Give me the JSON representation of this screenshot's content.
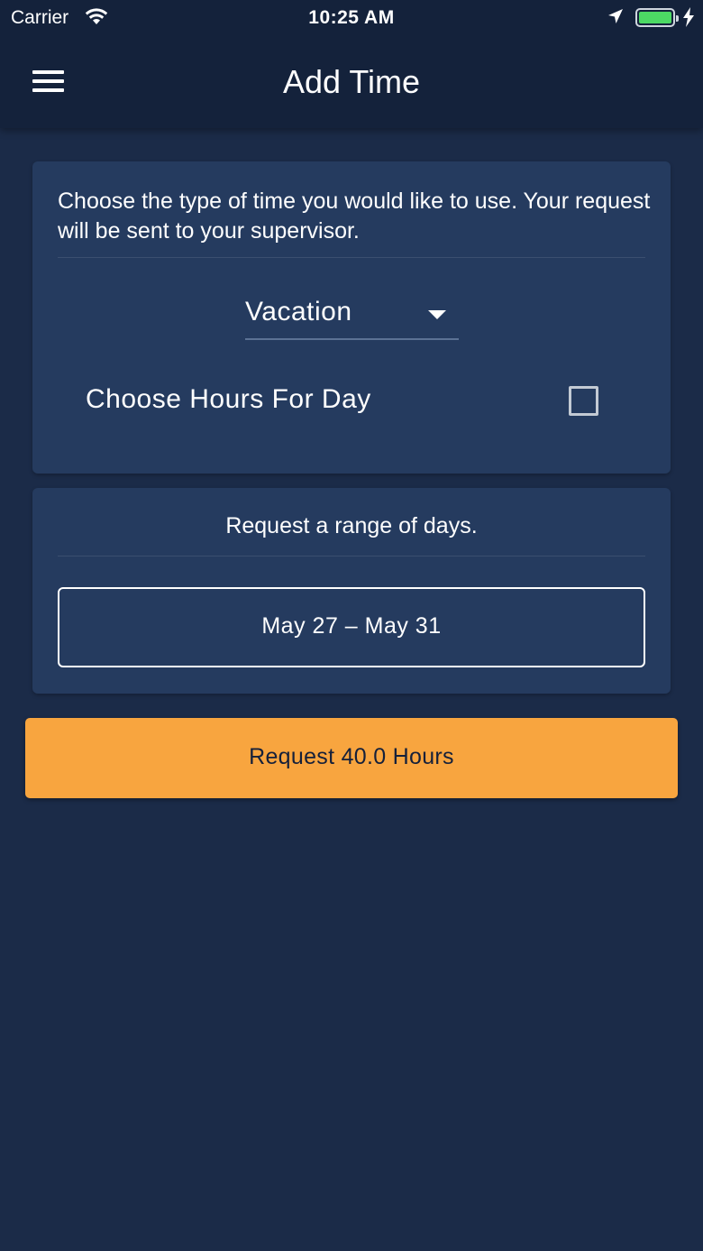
{
  "status_bar": {
    "carrier": "Carrier",
    "time": "10:25 AM",
    "battery_color": "#4cd964"
  },
  "header": {
    "title": "Add Time",
    "menu_icon": "hamburger-menu-icon"
  },
  "type_card": {
    "intro": "Choose the type of time you would like to use. Your request will be sent to your supervisor.",
    "time_type": {
      "selected": "Vacation"
    },
    "hours_toggle": {
      "label": "Choose Hours For Day",
      "checked": false
    }
  },
  "range_card": {
    "label": "Request a range of days.",
    "date_range": "May 27 – May 31"
  },
  "submit": {
    "label": "Request 40.0 Hours"
  },
  "colors": {
    "background": "#1b2b48",
    "header": "#14223b",
    "card": "#253b5f",
    "accent": "#f8a53f"
  }
}
